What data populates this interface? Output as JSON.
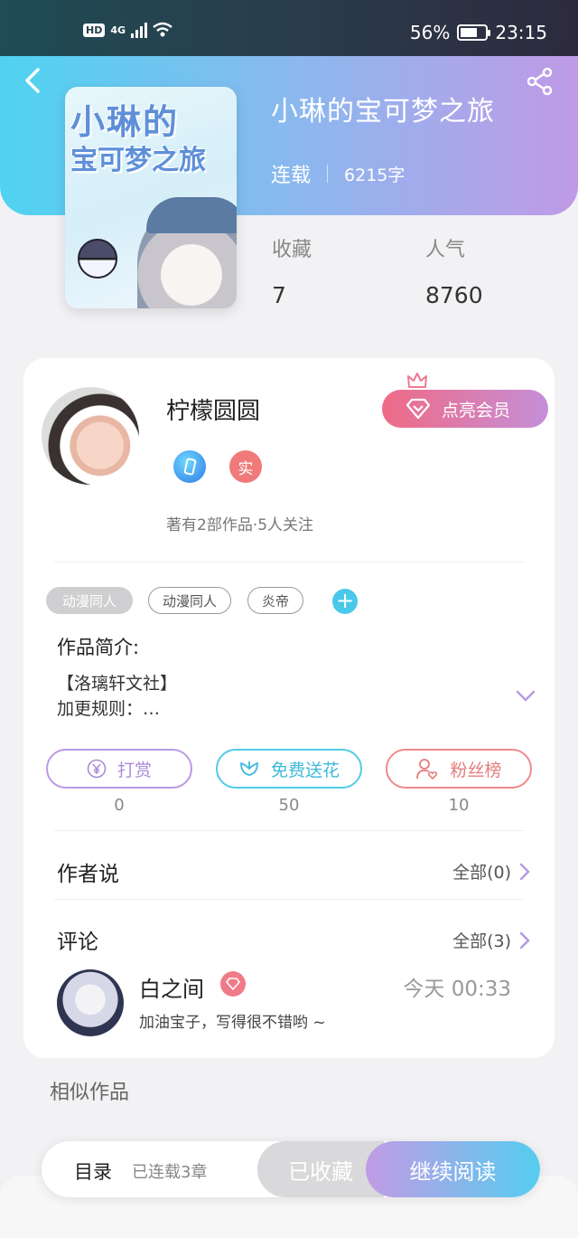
{
  "status_bar": {
    "battery": "56%",
    "time": "23:15",
    "network": "4G"
  },
  "book": {
    "title": "小琳的宝可梦之旅",
    "status": "连载",
    "word_count": "6215字",
    "cover_title_line1": "小琳的",
    "cover_title_line2": "宝可梦之旅",
    "stats": [
      {
        "label": "收藏",
        "value": "7"
      },
      {
        "label": "人气",
        "value": "8760"
      }
    ]
  },
  "author": {
    "name": "柠檬圆圆",
    "badge_real": "实",
    "info": "著有2部作品·5人关注",
    "vip_button": "点亮会员"
  },
  "tags": [
    "动漫同人",
    "动漫同人",
    "炎帝"
  ],
  "tag_add": "+",
  "intro": {
    "heading": "作品简介:",
    "line1": "【洛璃轩文社】",
    "line2": "加更规则：…"
  },
  "actions": [
    {
      "label": "打赏",
      "count": "0",
      "icon": "yen-icon"
    },
    {
      "label": "免费送花",
      "count": "50",
      "icon": "flower-icon"
    },
    {
      "label": "粉丝榜",
      "count": "10",
      "icon": "user-heart-icon"
    }
  ],
  "author_says": {
    "title": "作者说",
    "more": "全部(0)"
  },
  "comments": {
    "title": "评论",
    "more": "全部(3)",
    "items": [
      {
        "user": "白之间",
        "time": "今天 00:33",
        "text": "加油宝子，写得很不错哟 ~"
      }
    ]
  },
  "similar_title": "相似作品",
  "bottom_bar": {
    "toc": "目录",
    "chapters": "已连载3章",
    "saved": "已收藏",
    "continue": "继续阅读"
  },
  "colors": {
    "hero_start": "#4fd3f0",
    "hero_end": "#c09ae6",
    "vip_start": "#ef6a86",
    "read_end": "#55cdef"
  }
}
